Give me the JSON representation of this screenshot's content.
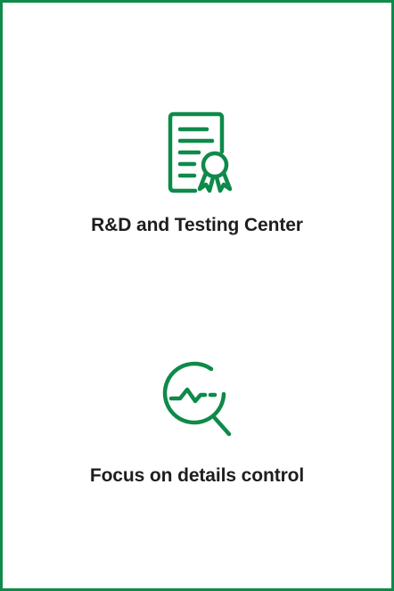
{
  "theme": {
    "accent": "#0e8a4a",
    "text": "#1e1e1e",
    "background": "#ffffff"
  },
  "features": [
    {
      "icon": "certificate-icon",
      "title": "R&D and Testing Center"
    },
    {
      "icon": "magnifier-trend-icon",
      "title": "Focus on details control"
    }
  ]
}
